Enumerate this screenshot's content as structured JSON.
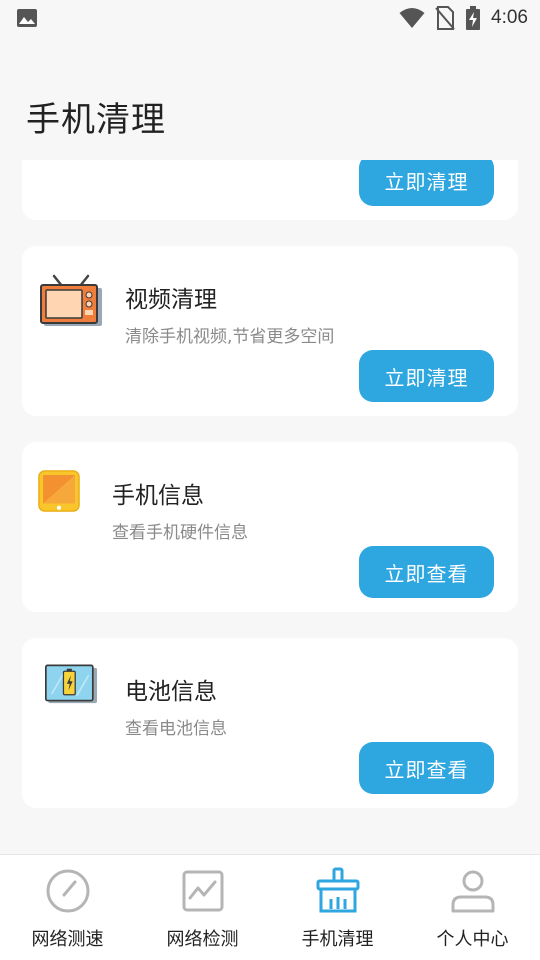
{
  "status_bar": {
    "time": "4:06",
    "icons": [
      "image-icon",
      "wifi-icon",
      "no-sim-icon",
      "battery-charging-icon"
    ]
  },
  "page": {
    "title": "手机清理"
  },
  "cards": [
    {
      "icon": "partial-card",
      "title": "",
      "desc": "",
      "button": "立即清理"
    },
    {
      "icon": "tv-icon",
      "title": "视频清理",
      "desc": "清除手机视频,节省更多空间",
      "button": "立即清理"
    },
    {
      "icon": "phone-info-icon",
      "title": "手机信息",
      "desc": "查看手机硬件信息",
      "button": "立即查看"
    },
    {
      "icon": "battery-info-icon",
      "title": "电池信息",
      "desc": "查看电池信息",
      "button": "立即查看"
    }
  ],
  "nav": {
    "items": [
      {
        "label": "网络测速",
        "icon": "speedometer-icon",
        "active": false
      },
      {
        "label": "网络检测",
        "icon": "line-chart-icon",
        "active": false
      },
      {
        "label": "手机清理",
        "icon": "broom-icon",
        "active": true
      },
      {
        "label": "个人中心",
        "icon": "user-icon",
        "active": false
      }
    ],
    "active_color": "#2ea6e0",
    "inactive_color": "#b5b5b5"
  },
  "colors": {
    "accent": "#2ea6e0",
    "background": "#f7f7f7"
  }
}
